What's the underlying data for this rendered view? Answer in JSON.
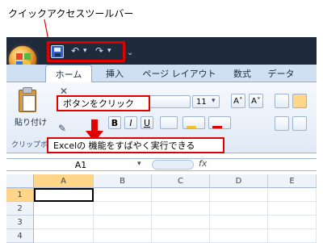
{
  "callouts": {
    "qat": "クイックアクセスツールバー",
    "button": "ボタンをクリック",
    "excel": "Excelの 機能をすばやく実行できる"
  },
  "tabs": [
    "ホーム",
    "挿入",
    "ページ レイアウト",
    "数式",
    "データ"
  ],
  "ribbon": {
    "paste_label": "貼り付け",
    "clipboard_label": "クリップボ",
    "font_size": "11",
    "bold": "B",
    "italic": "I",
    "underline": "U",
    "grow_font": "A˄",
    "shrink_font": "A˅"
  },
  "formula_bar": {
    "name_box": "A1",
    "fx": "fx"
  },
  "sheet": {
    "columns": [
      "A",
      "B",
      "C",
      "D",
      "E"
    ],
    "rows": [
      "1",
      "2",
      "3",
      "4"
    ]
  },
  "colors": {
    "accent_red": "#e00000",
    "titlebar": "#1f2a3b",
    "ribbon": "#dfe9f6"
  },
  "icons": {
    "save": "save-icon",
    "undo": "undo-icon",
    "redo": "redo-icon"
  }
}
